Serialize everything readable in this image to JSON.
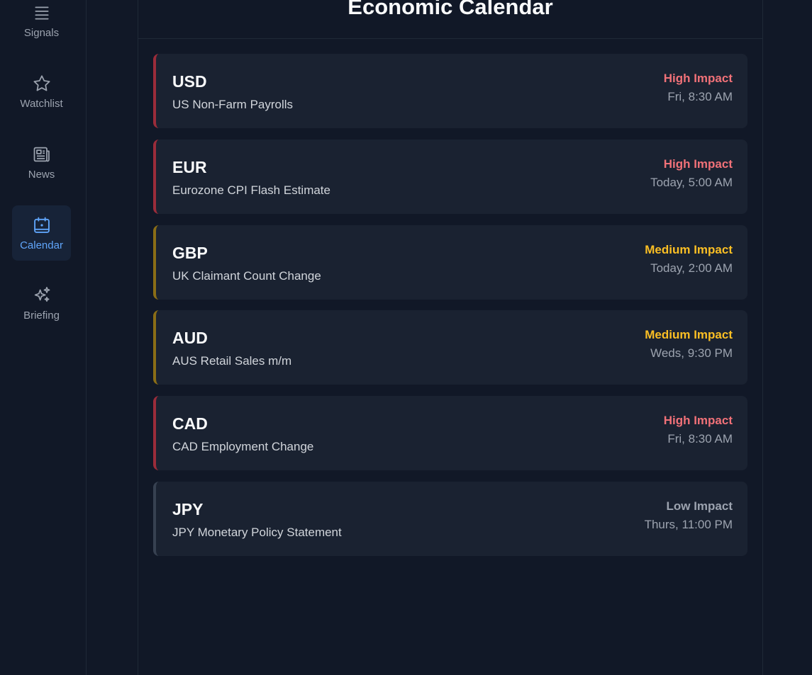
{
  "sidebar": {
    "items": [
      {
        "label": "Signals",
        "icon": "list-icon"
      },
      {
        "label": "Watchlist",
        "icon": "star-icon"
      },
      {
        "label": "News",
        "icon": "newspaper-icon"
      },
      {
        "label": "Calendar",
        "icon": "calendar-icon",
        "active": true
      },
      {
        "label": "Briefing",
        "icon": "sparkles-icon"
      }
    ]
  },
  "header": {
    "title": "Economic Calendar"
  },
  "events": [
    {
      "currency": "USD",
      "name": "US Non-Farm Payrolls",
      "impact": "High Impact",
      "level": "high",
      "time": "Fri, 8:30 AM"
    },
    {
      "currency": "EUR",
      "name": "Eurozone CPI Flash Estimate",
      "impact": "High Impact",
      "level": "high",
      "time": "Today, 5:00 AM"
    },
    {
      "currency": "GBP",
      "name": "UK Claimant Count Change",
      "impact": "Medium Impact",
      "level": "medium",
      "time": "Today, 2:00 AM"
    },
    {
      "currency": "AUD",
      "name": "AUS Retail Sales m/m",
      "impact": "Medium Impact",
      "level": "medium",
      "time": "Weds, 9:30 PM"
    },
    {
      "currency": "CAD",
      "name": "CAD Employment Change",
      "impact": "High Impact",
      "level": "high",
      "time": "Fri, 8:30 AM"
    },
    {
      "currency": "JPY",
      "name": "JPY Monetary Policy Statement",
      "impact": "Low Impact",
      "level": "low",
      "time": "Thurs, 11:00 PM"
    }
  ],
  "colors": {
    "background": "#111827",
    "card": "#1a2231",
    "accent": "#60a5fa",
    "high": "#f07178",
    "medium": "#fbbf24",
    "low": "#9ca3af"
  }
}
